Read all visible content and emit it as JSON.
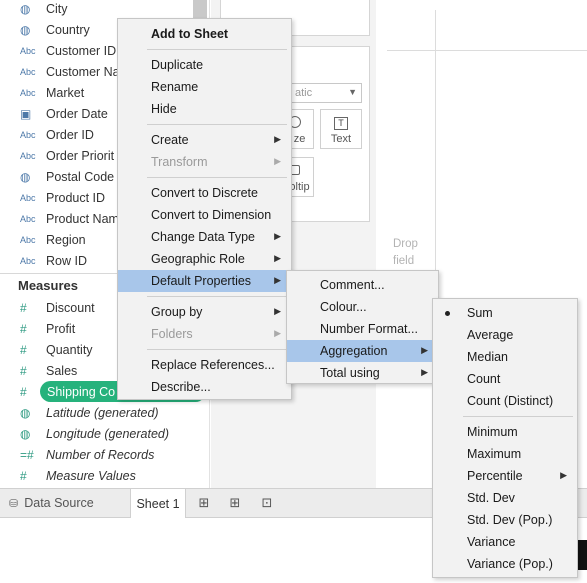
{
  "data_pane": {
    "dimensions": [
      {
        "label": "City",
        "icon": "globe-icon",
        "glyph": "◍"
      },
      {
        "label": "Country",
        "icon": "globe-icon",
        "glyph": "◍"
      },
      {
        "label": "Customer ID",
        "icon": "abc-icon",
        "glyph": "Abc"
      },
      {
        "label": "Customer Na",
        "icon": "abc-icon",
        "glyph": "Abc"
      },
      {
        "label": "Market",
        "icon": "abc-icon",
        "glyph": "Abc"
      },
      {
        "label": "Order Date",
        "icon": "calendar-icon",
        "glyph": "▣"
      },
      {
        "label": "Order ID",
        "icon": "abc-icon",
        "glyph": "Abc"
      },
      {
        "label": "Order Priorit",
        "icon": "abc-icon",
        "glyph": "Abc"
      },
      {
        "label": "Postal Code",
        "icon": "globe-icon",
        "glyph": "◍"
      },
      {
        "label": "Product ID",
        "icon": "abc-icon",
        "glyph": "Abc"
      },
      {
        "label": "Product Nam",
        "icon": "abc-icon",
        "glyph": "Abc"
      },
      {
        "label": "Region",
        "icon": "abc-icon",
        "glyph": "Abc"
      },
      {
        "label": "Row ID",
        "icon": "abc-icon",
        "glyph": "Abc"
      }
    ],
    "measures_header": "Measures",
    "measures": [
      {
        "label": "Discount",
        "icon": "hash-icon",
        "glyph": "#",
        "italic": false
      },
      {
        "label": "Profit",
        "icon": "hash-icon",
        "glyph": "#",
        "italic": false
      },
      {
        "label": "Quantity",
        "icon": "hash-icon",
        "glyph": "#",
        "italic": false
      },
      {
        "label": "Sales",
        "icon": "hash-icon",
        "glyph": "#",
        "italic": false
      },
      {
        "label": "Shipping Co",
        "icon": "hash-icon",
        "glyph": "#",
        "italic": false,
        "selected": true
      },
      {
        "label": "Latitude (generated)",
        "icon": "globe-icon",
        "glyph": "◍",
        "italic": true
      },
      {
        "label": "Longitude (generated)",
        "icon": "globe-icon",
        "glyph": "◍",
        "italic": true
      },
      {
        "label": "Number of Records",
        "icon": "hash-icon",
        "glyph": "=#",
        "italic": true
      },
      {
        "label": "Measure Values",
        "icon": "hash-icon",
        "glyph": "#",
        "italic": true
      }
    ]
  },
  "marks_card": {
    "mark_type_value": "atic",
    "buttons": [
      {
        "label": "ze",
        "icon": "size-icon"
      },
      {
        "label": "Text",
        "icon": "text-icon"
      },
      {
        "label": "oltip",
        "icon": "tooltip-icon"
      }
    ]
  },
  "view": {
    "drop_field_line1": "Drop",
    "drop_field_line2": "field"
  },
  "tabs": {
    "data_source": "Data Source",
    "sheet": "Sheet 1"
  },
  "context_menu": {
    "items": [
      {
        "label": "Add to Sheet",
        "bold": true
      },
      {
        "sep": true
      },
      {
        "label": "Duplicate"
      },
      {
        "label": "Rename"
      },
      {
        "label": "Hide"
      },
      {
        "sep": true
      },
      {
        "label": "Create",
        "submenu": true
      },
      {
        "label": "Transform",
        "submenu": true,
        "disabled": true
      },
      {
        "sep": true
      },
      {
        "label": "Convert to Discrete"
      },
      {
        "label": "Convert to Dimension"
      },
      {
        "label": "Change Data Type",
        "submenu": true
      },
      {
        "label": "Geographic Role",
        "submenu": true
      },
      {
        "label": "Default Properties",
        "submenu": true,
        "highlight": true
      },
      {
        "sep": true
      },
      {
        "label": "Group by",
        "submenu": true
      },
      {
        "label": "Folders",
        "submenu": true,
        "disabled": true
      },
      {
        "sep": true
      },
      {
        "label": "Replace References..."
      },
      {
        "label": "Describe..."
      }
    ]
  },
  "default_properties_menu": {
    "items": [
      {
        "label": "Comment..."
      },
      {
        "label": "Colour..."
      },
      {
        "label": "Number Format..."
      },
      {
        "label": "Aggregation",
        "submenu": true,
        "highlight": true
      },
      {
        "label": "Total using",
        "submenu": true
      }
    ]
  },
  "aggregation_menu": {
    "items": [
      {
        "label": "Sum",
        "checked": true
      },
      {
        "label": "Average"
      },
      {
        "label": "Median"
      },
      {
        "label": "Count"
      },
      {
        "label": "Count (Distinct)"
      },
      {
        "sep": true
      },
      {
        "label": "Minimum"
      },
      {
        "label": "Maximum"
      },
      {
        "label": "Percentile",
        "submenu": true
      },
      {
        "label": "Std. Dev"
      },
      {
        "label": "Std. Dev (Pop.)"
      },
      {
        "label": "Variance"
      },
      {
        "label": "Variance (Pop.)"
      }
    ]
  },
  "colors": {
    "selected_pill": "#26b27c",
    "menu_highlight": "#a8c6ea",
    "menu_background": "#f2f2f2"
  }
}
